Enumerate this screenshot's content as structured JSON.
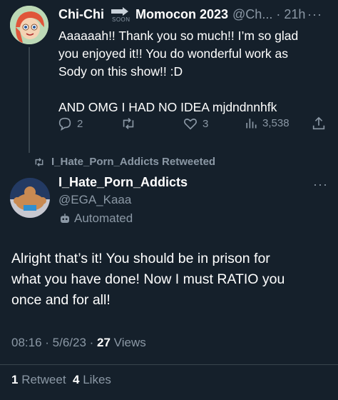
{
  "reply": {
    "display_name": "Chi-Chi",
    "soon_label": "SOON",
    "next_name": "Momocon 2023",
    "handle_time": "@Ch... · 21h",
    "more": "···",
    "text_lines": [
      "Aaaaaah!! Thank you so much!! I’m so glad",
      "you enjoyed it!! You do wonderful work as",
      "Sody on this show!! :D",
      "",
      "AND OMG I HAD NO IDEA mjdndnnhfk"
    ],
    "replies": "2",
    "retweets": "",
    "likes": "3",
    "views": "3,538"
  },
  "retweet_bar": {
    "text": "I_Hate_Porn_Addicts Retweeted"
  },
  "main": {
    "display_name": "I_Hate_Porn_Addicts",
    "handle": "@EGA_Kaaa",
    "automated": "Automated",
    "more": "···",
    "text_lines": [
      "Alright that’s it! You should be in prison for",
      "what you have done! Now I must RATIO you",
      "once and for all!"
    ],
    "time_date": "08:16 · 5/6/23 · ",
    "views_count": "27",
    "views_label": " Views",
    "retweet_count": "1",
    "retweet_label": " Retweet  ",
    "likes_count": "4",
    "likes_label": " Likes"
  },
  "colors": {
    "background": "#15202b",
    "muted": "#8b98a5",
    "text": "#ffffff"
  }
}
